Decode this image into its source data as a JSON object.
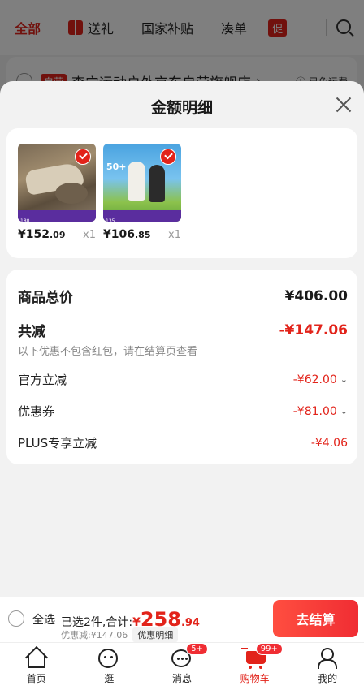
{
  "background": {
    "tabs": [
      {
        "label": "全部"
      },
      {
        "label": "送礼"
      },
      {
        "label": "国家补贴"
      },
      {
        "label": "凑单"
      }
    ],
    "promo_label": "促",
    "store": {
      "badge": "自营",
      "name": "李宁运动户外京东自营旗舰店",
      "arrow": "›",
      "shipping": "ⓘ 已免运费"
    }
  },
  "sheet": {
    "title": "金额明细",
    "products": [
      {
        "price_symbol": "¥",
        "price_main": "152",
        "price_decimal": ".09",
        "quantity": "x1",
        "image_text": "",
        "stripe_text": "180",
        "stripe_color": "#5a2d9e"
      },
      {
        "price_symbol": "¥",
        "price_main": "106",
        "price_decimal": ".85",
        "quantity": "x1",
        "image_text": "50+",
        "stripe_text": "135",
        "stripe_color": "#5a2d9e"
      }
    ],
    "summary": {
      "goods_total_label": "商品总价",
      "goods_total_value": "¥406.00",
      "total_reduction_label": "共减",
      "total_reduction_value": "-¥147.06",
      "reduction_note": "以下优惠不包含红包，请在结算页查看",
      "official_label": "官方立减",
      "official_value": "-¥62.00",
      "coupon_label": "优惠券",
      "coupon_value": "-¥81.00",
      "plus_label": "PLUS专享立减",
      "plus_value": "-¥4.06",
      "chevron": "⌄"
    }
  },
  "checkout": {
    "select_all": "全选",
    "selected_text": "已选2件,合计:",
    "total_symbol": "¥",
    "total_main": "258",
    "total_decimal": ".94",
    "discount_text": "优惠减:¥147.06",
    "detail_link": "优惠明细",
    "checkout_button": "去结算"
  },
  "nav": {
    "items": [
      {
        "label": "首页"
      },
      {
        "label": "逛"
      },
      {
        "label": "消息",
        "badge": "5+"
      },
      {
        "label": "购物车",
        "badge": "99+"
      },
      {
        "label": "我的"
      }
    ]
  },
  "colors": {
    "accent": "#e2231a",
    "checkout_gradient_start": "#ff4e40",
    "checkout_gradient_end": "#f02d33"
  }
}
